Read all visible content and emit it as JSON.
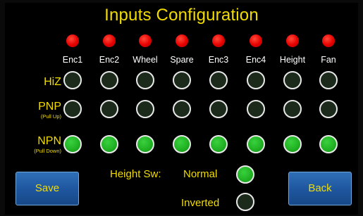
{
  "title": "Inputs Configuration",
  "columns": [
    "Enc1",
    "Enc2",
    "Wheel",
    "Spare",
    "Enc3",
    "Enc4",
    "Height",
    "Fan"
  ],
  "rows": [
    {
      "label": "HiZ",
      "sublabel": "",
      "states": [
        false,
        false,
        false,
        false,
        false,
        false,
        false,
        false
      ]
    },
    {
      "label": "PNP",
      "sublabel": "(Pull Up)",
      "states": [
        false,
        false,
        false,
        false,
        false,
        false,
        false,
        false
      ]
    },
    {
      "label": "NPN",
      "sublabel": "(Pull Down)",
      "states": [
        true,
        true,
        true,
        true,
        true,
        true,
        true,
        true
      ]
    }
  ],
  "height_switch": {
    "label": "Height Sw:",
    "normal_label": "Normal",
    "inverted_label": "Inverted",
    "normal_selected": true,
    "inverted_selected": false
  },
  "buttons": {
    "save": "Save",
    "back": "Back"
  },
  "colors": {
    "accent_text": "#f2dc00",
    "led_red": "#e60000",
    "radio_on": "#1fb022",
    "button_blue": "#1f57a0"
  }
}
